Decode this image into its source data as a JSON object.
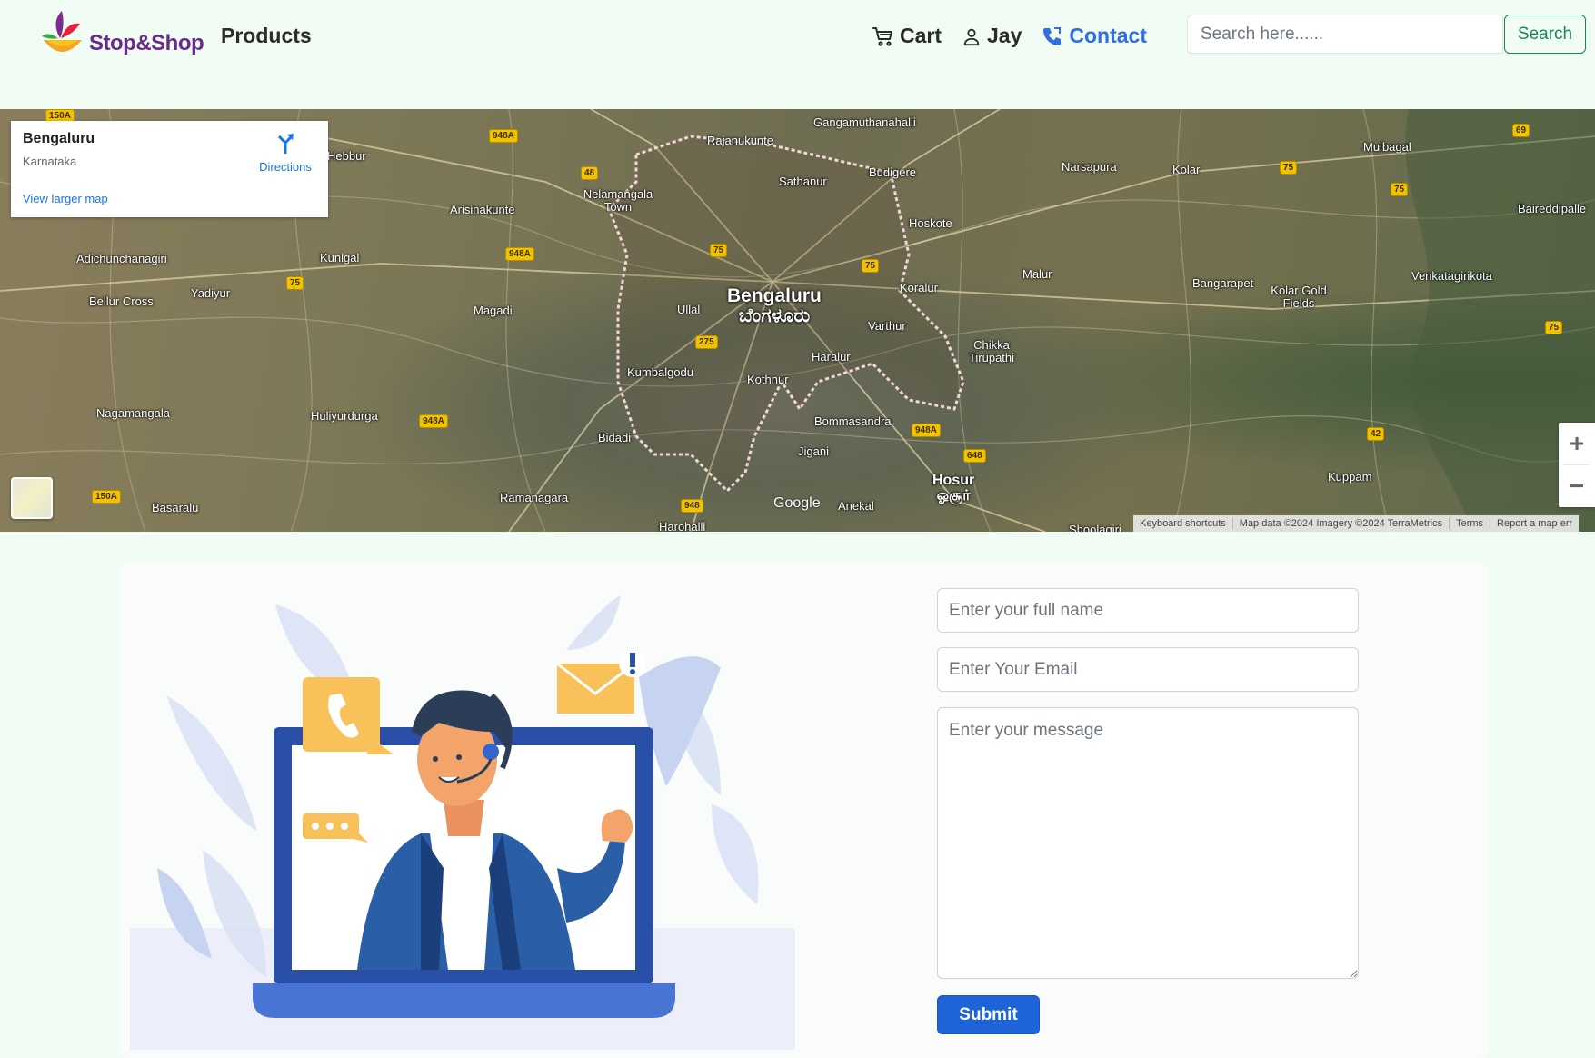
{
  "nav": {
    "brand": "Stop&Shop",
    "products_label": "Products",
    "cart_label": "Cart",
    "user_label": "Jay",
    "contact_label": "Contact",
    "search_placeholder": "Search here......",
    "search_button": "Search",
    "active_color": "#2f6ee3",
    "accent_green": "#198754"
  },
  "map": {
    "place_title": "Bengaluru",
    "place_subtitle": "Karnataka",
    "view_larger": "View larger map",
    "directions": "Directions",
    "zoom_in": "+",
    "zoom_out": "−",
    "watermark": "Google",
    "attribution": [
      "Keyboard shortcuts",
      "Map data ©2024 Imagery ©2024 TerraMetrics",
      "Terms",
      "Report a map err"
    ],
    "labels": {
      "bengaluru": "Bengaluru",
      "bengaluru_kn": "ಬೆಂಗಳೂರು",
      "hosur": "Hosur",
      "hosur_ta": "ஓசூர்",
      "gangamuthanahalli": "Gangamuthanahalli",
      "rajanukunte": "Rajanukunte",
      "sathanur": "Sathanur",
      "budigere": "Budigere",
      "nelamangala": "Nelamangala Town",
      "hoskote": "Hoskote",
      "narsapura": "Narsapura",
      "kolar": "Kolar",
      "mulbagal": "Mulbagal",
      "hebbur": "Hebbur",
      "arisinakunte": "Arisinakunte",
      "adichunchanagiri": "Adichunchanagiri",
      "kunigal": "Kunigal",
      "bellur_cross": "Bellur Cross",
      "yadiyur": "Yadiyur",
      "magadi": "Magadi",
      "ullal": "Ullal",
      "koralur": "Koralur",
      "varthur": "Varthur",
      "malur": "Malur",
      "bangarapet": "Bangarapet",
      "kolar_gold_fields": "Kolar Gold Fields",
      "venkatagirikota": "Venkatagirikota",
      "baireddipalle": "Baireddipalle",
      "chikka_tirupathi": "Chikka Tirupathi",
      "haralur": "Haralur",
      "kumbalgodu": "Kumbalgodu",
      "kothnur": "Kothnur",
      "nagamangala": "Nagamangala",
      "hulivurdurga": "Huliyurdurga",
      "bommasandra": "Bommasandra",
      "bidadi": "Bidadi",
      "jigani": "Jigani",
      "anekal": "Anekal",
      "ramanagara": "Ramanagara",
      "basaralu": "Basaralu",
      "kuppam": "Kuppam",
      "harohalli": "Harohalli",
      "shoolagiri": "Shoolagiri"
    },
    "roads": [
      "150A",
      "948A",
      "48",
      "948A",
      "75",
      "75",
      "75",
      "75",
      "69",
      "75",
      "275",
      "948A",
      "648",
      "948A",
      "42",
      "150A",
      "948",
      "75"
    ]
  },
  "form": {
    "name_placeholder": "Enter your full name",
    "email_placeholder": "Enter Your Email",
    "message_placeholder": "Enter your message",
    "submit_label": "Submit",
    "submit_color": "#1e63d8"
  }
}
